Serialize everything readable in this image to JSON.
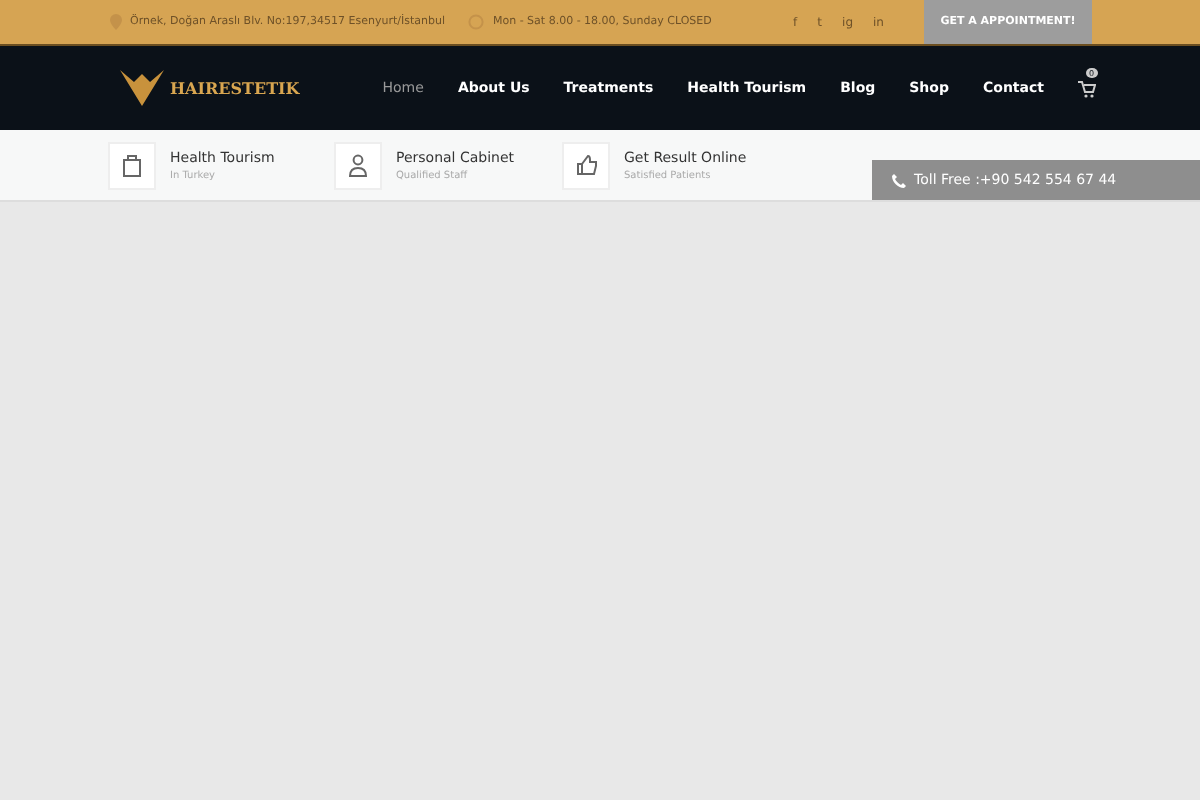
{
  "topbar": {
    "address": "Örnek, Doğan Araslı Blv. No:197,34517 Esenyurt/İstanbul",
    "hours": "Mon - Sat 8.00 - 18.00, Sunday CLOSED",
    "social": [
      "f",
      "t",
      "ig",
      "in"
    ],
    "cta": "GET A APPOINTMENT!"
  },
  "logo": {
    "text": "HAIRESTETIK"
  },
  "nav": [
    {
      "label": "Home",
      "selected": true
    },
    {
      "label": "About Us",
      "selected": false
    },
    {
      "label": "Treatments",
      "selected": false
    },
    {
      "label": "Health Tourism",
      "selected": false
    },
    {
      "label": "Blog",
      "selected": false
    },
    {
      "label": "Shop",
      "selected": false
    },
    {
      "label": "Contact",
      "selected": false
    }
  ],
  "cart": {
    "count": "0"
  },
  "features": [
    {
      "kind": "bag",
      "title": "Health Tourism",
      "subtitle": "In Turkey"
    },
    {
      "kind": "person",
      "title": "Personal Cabinet",
      "subtitle": "Qualified Staff"
    },
    {
      "kind": "thumb",
      "title": "Get Result Online",
      "subtitle": "Satisfied Patients"
    }
  ],
  "toll_free": "Toll Free :+90 542 554 67 44"
}
